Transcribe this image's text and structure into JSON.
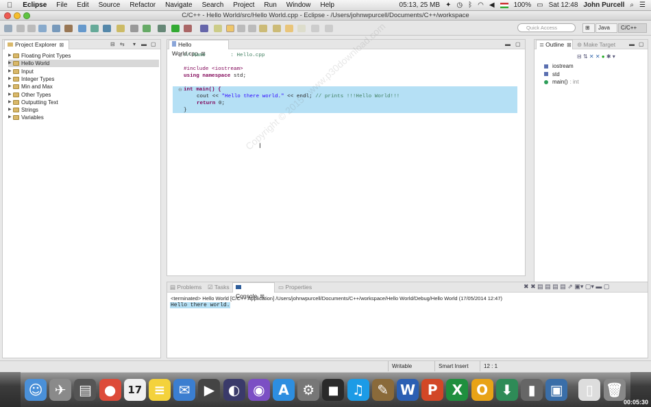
{
  "menubar": {
    "app": "Eclipse",
    "items": [
      "File",
      "Edit",
      "Source",
      "Refactor",
      "Navigate",
      "Search",
      "Project",
      "Run",
      "Window",
      "Help"
    ],
    "memory": "05:13, 25 MB",
    "battery": "100%",
    "clock": "Sat 12:48",
    "user": "John Purcell"
  },
  "window": {
    "title": "C/C++ - Hello World/src/Hello World.cpp - Eclipse - /Users/johnwpurcell/Documents/C++/workspace"
  },
  "toolbar": {
    "quick_access_placeholder": "Quick Access",
    "persp_java": "Java",
    "persp_cpp": "C/C++"
  },
  "project_explorer": {
    "title": "Project Explorer",
    "items": [
      "Floating Point Types",
      "Hello World",
      "Input",
      "Integer Types",
      "Min and Max",
      "Other Types",
      "Outputting Text",
      "Strings",
      "Variables"
    ],
    "selected_index": 1
  },
  "editor": {
    "tab": "Hello World.cpp",
    "name_comment": "// Name        : Hello.cpp",
    "include": "#include <iostream>",
    "using_kw": "using namespace",
    "using_rest": " std;",
    "main_sig": "int main() {",
    "cout_pre": "cout << ",
    "cout_str": "\"Hello there world.\"",
    "cout_post": " << endl; ",
    "cout_comment": "// prints !!!Hello World!!!",
    "return_kw": "return",
    "return_rest": " 0;",
    "close_brace": "}"
  },
  "outline": {
    "title": "Outline",
    "make_target": "Make Target",
    "items": [
      {
        "label": "iostream",
        "type": "",
        "color": "#5a6fb0"
      },
      {
        "label": "std",
        "type": "",
        "color": "#5a6fb0"
      },
      {
        "label": "main()",
        "type": ": int",
        "color": "#2e9e5a"
      }
    ]
  },
  "console": {
    "tabs": [
      "Problems",
      "Tasks",
      "Console",
      "Properties"
    ],
    "active_tab": "Console",
    "header": "<terminated> Hello World [C/C++ Application] /Users/johnwpurcell/Documents/C++/workspace/Hello World/Debug/Hello World (17/05/2014 12:47)",
    "output": "Hello there world."
  },
  "statusbar": {
    "mode": "Writable",
    "insert": "Smart Insert",
    "position": "12 : 1"
  },
  "watermark": "Copyright © 2015 - www.p30download.com",
  "video_timer": "00:05:30",
  "dock": {
    "calendar_day": "17",
    "apps": [
      {
        "name": "finder",
        "glyph": "☺",
        "color": "#4a90d9"
      },
      {
        "name": "launchpad",
        "glyph": "✈",
        "color": "#8a8a8a"
      },
      {
        "name": "scanner",
        "glyph": "▤",
        "color": "#555"
      },
      {
        "name": "chrome",
        "glyph": "●",
        "color": "#dd4b39"
      },
      {
        "name": "calendar",
        "glyph": "",
        "color": "#f0f0f0"
      },
      {
        "name": "stickies",
        "glyph": "≡",
        "color": "#f4d23c"
      },
      {
        "name": "mail",
        "glyph": "✉",
        "color": "#3b7ed0"
      },
      {
        "name": "facetime",
        "glyph": "▶",
        "color": "#444"
      },
      {
        "name": "eclipse",
        "glyph": "◐",
        "color": "#3a3a6a"
      },
      {
        "name": "orbit",
        "glyph": "◉",
        "color": "#7b4fc4"
      },
      {
        "name": "app-store",
        "glyph": "A",
        "color": "#2d8ee0"
      },
      {
        "name": "system-prefs",
        "glyph": "⚙",
        "color": "#777"
      },
      {
        "name": "photo-booth",
        "glyph": "◼",
        "color": "#2a2a2a"
      },
      {
        "name": "itunes",
        "glyph": "♫",
        "color": "#1c9be6"
      },
      {
        "name": "grapher",
        "glyph": "✎",
        "color": "#8a6a3a"
      },
      {
        "name": "word",
        "glyph": "W",
        "color": "#2b5fb3"
      },
      {
        "name": "powerpoint",
        "glyph": "P",
        "color": "#d24726"
      },
      {
        "name": "excel",
        "glyph": "X",
        "color": "#1f8f3e"
      },
      {
        "name": "outlook",
        "glyph": "O",
        "color": "#e8a317"
      },
      {
        "name": "downloads-globe",
        "glyph": "⬇",
        "color": "#2e8b57"
      },
      {
        "name": "microphone",
        "glyph": "▮",
        "color": "#666"
      },
      {
        "name": "screenflow",
        "glyph": "▣",
        "color": "#3a6ea8"
      },
      {
        "name": "document",
        "glyph": "▯",
        "color": "#ddd"
      },
      {
        "name": "trash",
        "glyph": "🗑",
        "color": "#888"
      }
    ]
  }
}
